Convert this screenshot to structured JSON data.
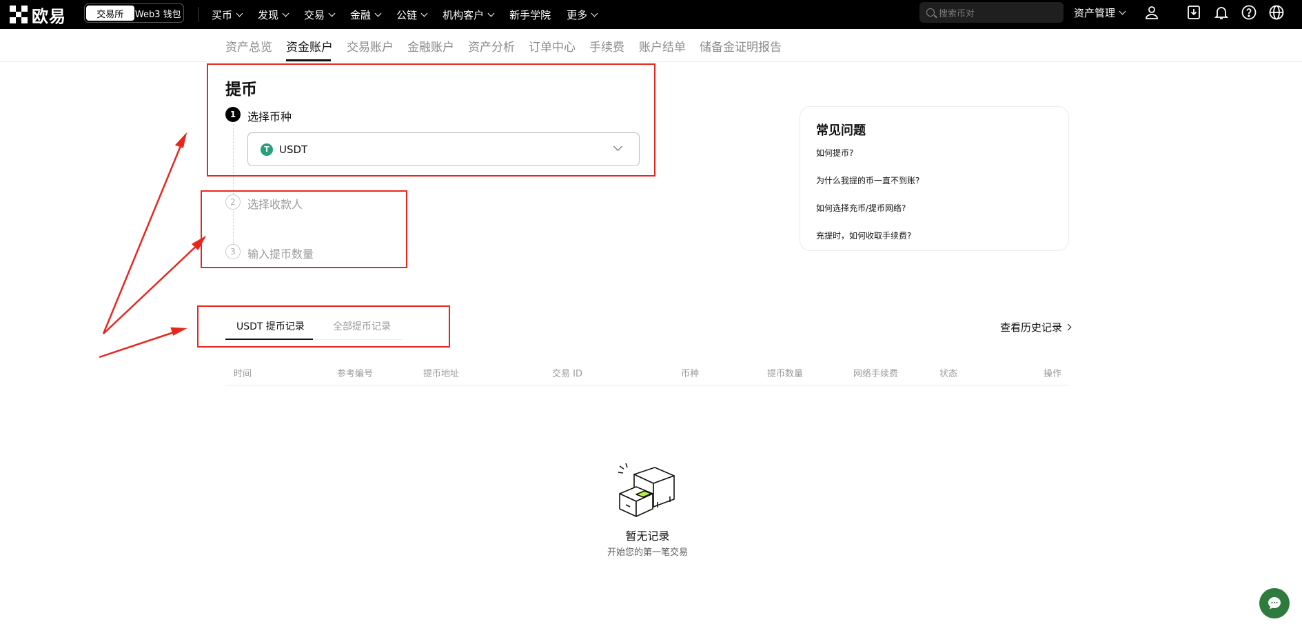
{
  "brand": {
    "name": "欧易"
  },
  "mode_switch": {
    "exchange": "交易所",
    "wallet": "Web3 钱包"
  },
  "nav": [
    {
      "label": "买币",
      "has_dropdown": true
    },
    {
      "label": "发现",
      "has_dropdown": true
    },
    {
      "label": "交易",
      "has_dropdown": true
    },
    {
      "label": "金融",
      "has_dropdown": true
    },
    {
      "label": "公链",
      "has_dropdown": true
    },
    {
      "label": "机构客户",
      "has_dropdown": true
    },
    {
      "label": "新手学院",
      "has_dropdown": false
    },
    {
      "label": "更多",
      "has_dropdown": true
    }
  ],
  "search": {
    "placeholder": "搜索币对",
    "icon": "search-icon"
  },
  "asset_management": {
    "label": "资产管理",
    "has_dropdown": true
  },
  "top_icons": [
    "user-icon",
    "download-icon",
    "bell-icon",
    "help-icon",
    "globe-icon"
  ],
  "subnav": {
    "items": [
      "资产总览",
      "资金账户",
      "交易账户",
      "金融账户",
      "资产分析",
      "订单中心",
      "手续费",
      "账户结单",
      "储备金证明报告"
    ],
    "active": "资金账户"
  },
  "withdraw": {
    "title": "提币",
    "steps": [
      {
        "num": "1",
        "label": "选择币种",
        "active": true
      },
      {
        "num": "2",
        "label": "选择收款人",
        "active": false
      },
      {
        "num": "3",
        "label": "输入提币数量",
        "active": false
      }
    ],
    "selected_coin": {
      "symbol": "USDT",
      "icon_glyph": "T",
      "icon_color": "#26a17b"
    }
  },
  "faq": {
    "title": "常见问题",
    "links": [
      "如何提币?",
      "为什么我提的币一直不到账?",
      "如何选择充币/提币网络?",
      "充提时，如何收取手续费?"
    ]
  },
  "records": {
    "tabs": [
      {
        "label": "USDT 提币记录",
        "active": true
      },
      {
        "label": "全部提币记录",
        "active": false
      }
    ],
    "history_link": "查看历史记录",
    "columns": [
      "时间",
      "参考编号",
      "提币地址",
      "交易 ID",
      "币种",
      "提币数量",
      "网络手续费",
      "状态",
      "操作"
    ],
    "empty_title": "暂无记录",
    "empty_subtitle": "开始您的第一笔交易"
  },
  "colors": {
    "annotation": "#e8261e",
    "chat_button": "#2f7a3d",
    "empty_accent": "#b6f23c"
  },
  "chat": {
    "icon": "chat-icon"
  }
}
